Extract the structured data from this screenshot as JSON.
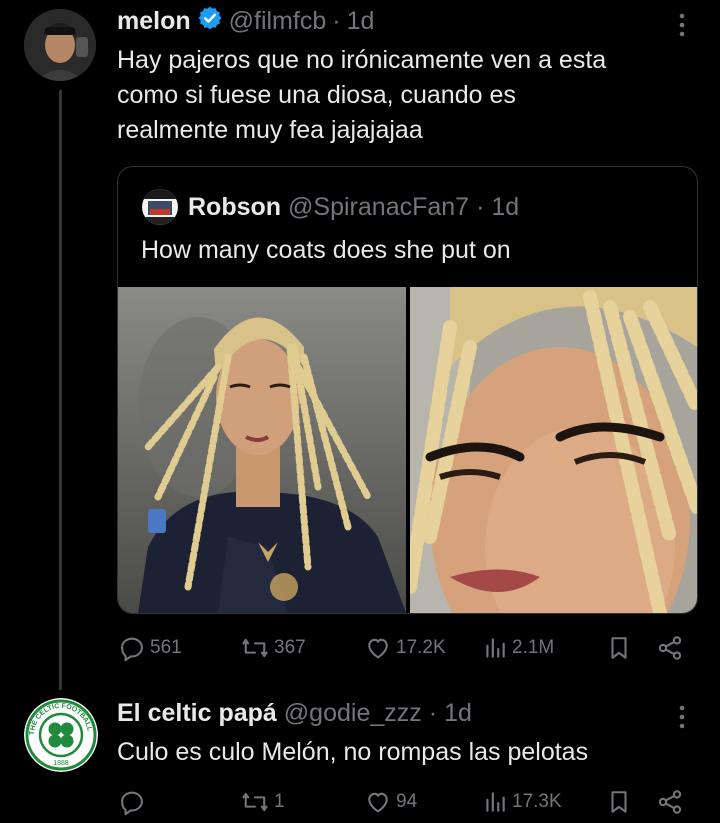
{
  "tweet1": {
    "name": "melon",
    "handle": "@filmfcb",
    "dot": "·",
    "time": "1d",
    "text_line1": "Hay pajeros que no irónicamente ven a esta",
    "text_line2": "como si fuese una diosa, cuando es",
    "text_line3": "realmente muy fea jajajajaa",
    "quote": {
      "name": "Robson",
      "handle": "@SpiranacFan7",
      "dot": "·",
      "time": "1d",
      "text": "How many coats does she put on"
    },
    "actions": {
      "replies": "561",
      "reposts": "367",
      "likes": "17.2K",
      "views": "2.1M"
    }
  },
  "tweet2": {
    "name": "El celtic papá",
    "handle": "@godie_zzz",
    "dot": "·",
    "time": "1d",
    "text": "Culo es culo Melón, no rompas las pelotas",
    "avatar_ring_text": "THE CELTIC FOOTBALL CLUB",
    "avatar_year": "1888",
    "actions": {
      "replies": "",
      "reposts": "1",
      "likes": "94",
      "views": "17.3K"
    }
  },
  "colors": {
    "background": "#000000",
    "text": "#e7e9ea",
    "muted": "#71767b",
    "verified": "#1d9bf0",
    "celtic_green": "#1f8a3b"
  }
}
